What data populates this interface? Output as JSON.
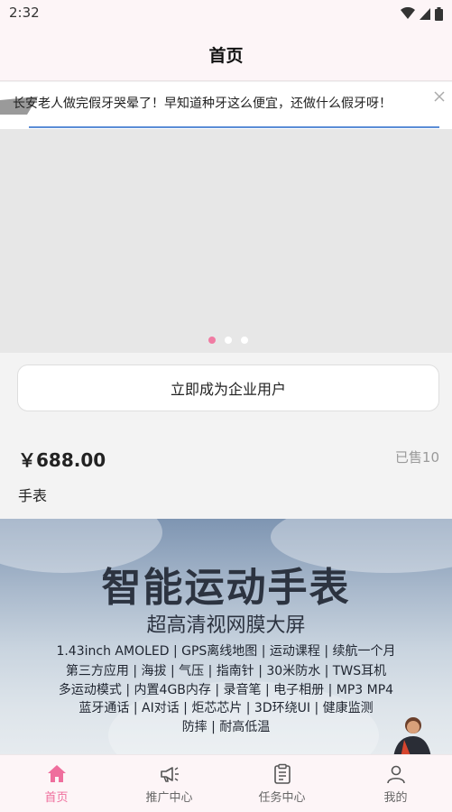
{
  "status_bar": {
    "time": "2:32"
  },
  "header": {
    "title": "首页"
  },
  "notice": {
    "text": "长安老人做完假牙哭晕了！早知道种牙这么便宜，还做什么假牙呀！"
  },
  "banner": {
    "dot_count": 3,
    "active_index": 0
  },
  "enterprise_button": {
    "label": "立即成为企业用户"
  },
  "product": {
    "price": "￥688.00",
    "sold": "已售10",
    "name": "手表"
  },
  "product_image": {
    "title": "智能运动手表",
    "subtitle": "超高清视网膜大屏",
    "spec_lines": [
      "1.43inch  AMOLED  |  GPS离线地图  |  运动课程  |  续航一个月",
      "第三方应用  |  海拔  |  气压  |  指南针  |  30米防水  |  TWS耳机",
      "多运动模式  |  内置4GB内存  |  录音笔  |  电子相册  |  MP3  MP4",
      "蓝牙通话  |  AI对话  |  炬芯芯片  |  3D环绕UI  |  健康监测",
      "防摔  |  耐高低温"
    ]
  },
  "tabs": [
    {
      "label": "首页",
      "icon": "home-icon",
      "active": true
    },
    {
      "label": "推广中心",
      "icon": "megaphone-icon",
      "active": false
    },
    {
      "label": "任务中心",
      "icon": "clipboard-icon",
      "active": false
    },
    {
      "label": "我的",
      "icon": "user-icon",
      "active": false
    }
  ],
  "colors": {
    "accent": "#ef6e9d",
    "tab_bar_bg": "#fdf5f7",
    "page_bg": "#f3f3f3"
  }
}
